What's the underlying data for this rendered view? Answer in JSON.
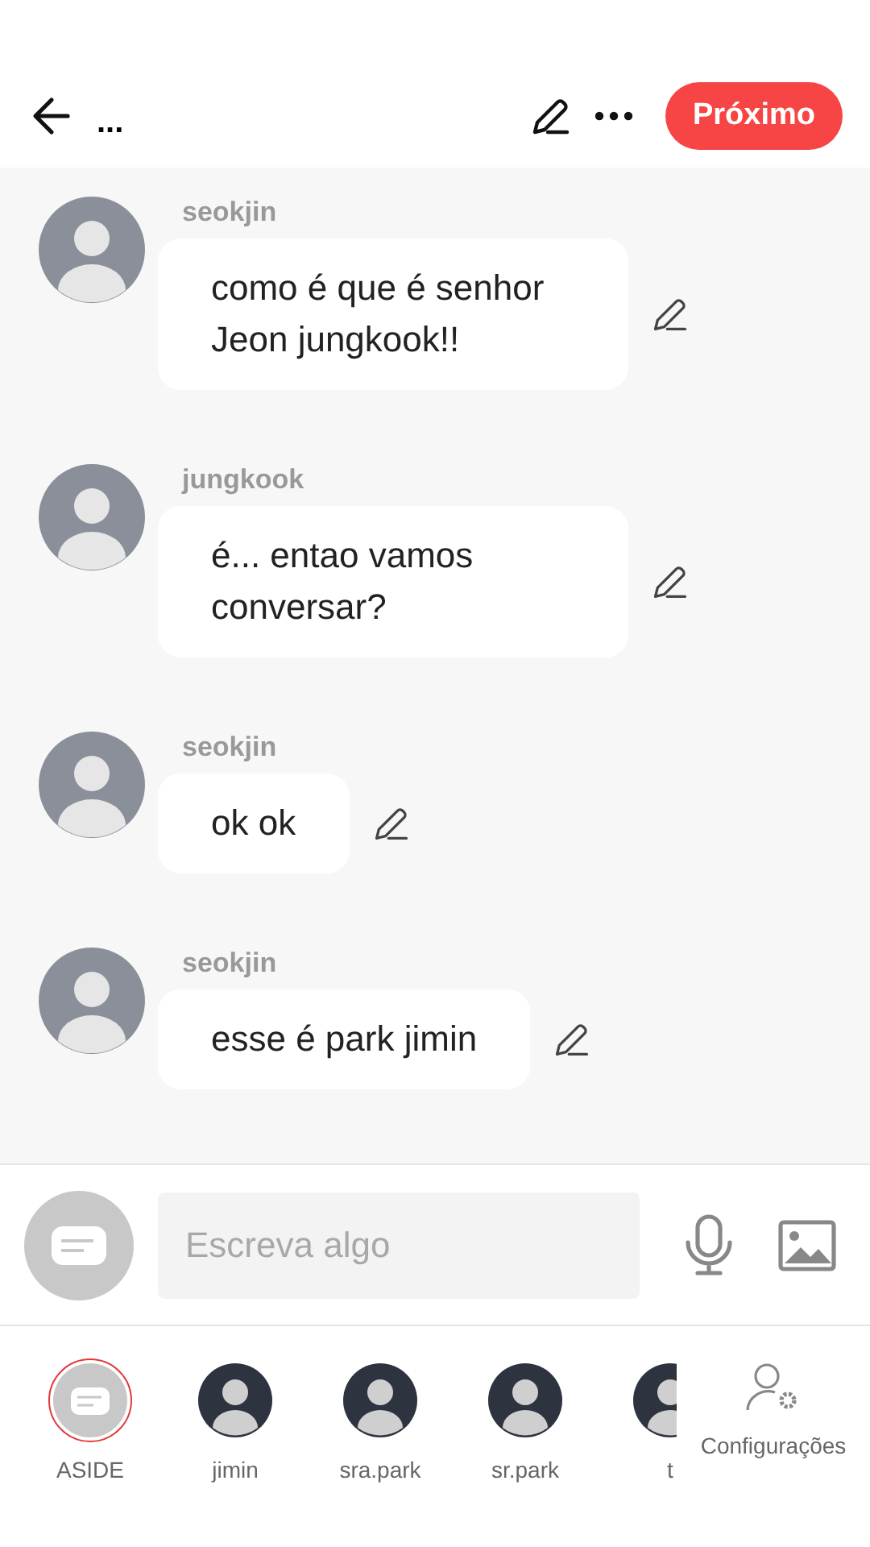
{
  "top_bar": {
    "title": "...",
    "next_button": "Próximo"
  },
  "messages": [
    {
      "author": "seokjin",
      "text": "como é que é senhor Jeon jungkook!!"
    },
    {
      "author": "jungkook",
      "text": "é... entao vamos conversar?"
    },
    {
      "author": "seokjin",
      "text": "ok ok"
    },
    {
      "author": "seokjin",
      "text": "esse é park jimin"
    }
  ],
  "composer": {
    "placeholder": "Escreva algo"
  },
  "cast": [
    {
      "name": "ASIDE",
      "kind": "aside",
      "selected": true
    },
    {
      "name": "jimin",
      "kind": "person",
      "selected": false
    },
    {
      "name": "sra.park",
      "kind": "person",
      "selected": false
    },
    {
      "name": "sr.park",
      "kind": "person",
      "selected": false
    },
    {
      "name": "t",
      "kind": "person",
      "selected": false
    }
  ],
  "settings": {
    "label": "Configurações"
  }
}
